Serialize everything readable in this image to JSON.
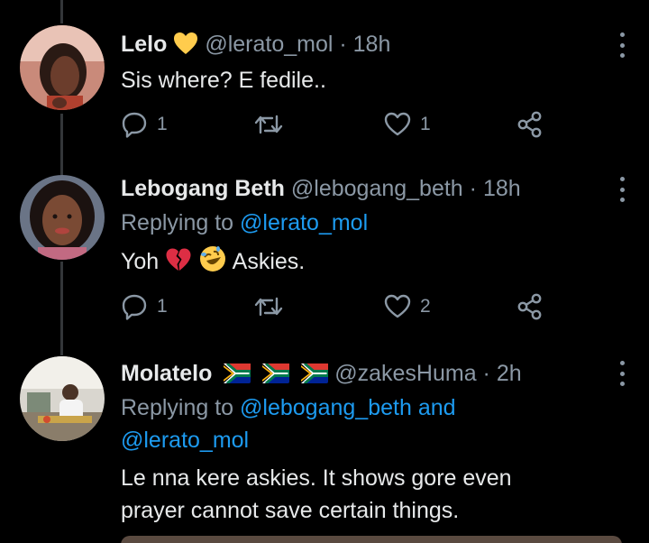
{
  "tweets": [
    {
      "name": "Lelo",
      "name_emoji": "yellow-heart",
      "handle": "@lerato_mol",
      "dot": "·",
      "time": "18h",
      "replying_label": "",
      "replying_to": [],
      "text_lines": [
        "Sis where? E fedile.."
      ],
      "replies": "1",
      "retweets": "",
      "likes": "1"
    },
    {
      "name": "Lebogang Beth",
      "handle": "@lebogang_beth",
      "dot": "·",
      "time": "18h",
      "replying_label": "Replying to",
      "replying_to": [
        "@lerato_mol"
      ],
      "text_before": "Yoh",
      "text_after": "Askies.",
      "emojis": [
        "broken-heart",
        "rolling-on-floor-laughing"
      ],
      "replies": "1",
      "retweets": "",
      "likes": "2"
    },
    {
      "name": "Molatelo",
      "name_emoji": "south-africa-flag x3",
      "handle": "@zakesHuma",
      "dot": "·",
      "time": "2h",
      "replying_label": "Replying to",
      "replying_to": [
        "@lebogang_beth",
        "@lerato_mol"
      ],
      "replying_joiner": "and",
      "text_lines": [
        "Le nna kere askies. It shows gore even",
        "prayer cannot save certain things."
      ]
    }
  ],
  "colors": {
    "background": "#000000",
    "text": "#e7e9ea",
    "muted": "#8b98a5",
    "link": "#1d9bf0",
    "thread_line": "#333639"
  },
  "icons": [
    "reply-icon",
    "retweet-icon",
    "like-icon",
    "share-icon",
    "more-icon"
  ]
}
